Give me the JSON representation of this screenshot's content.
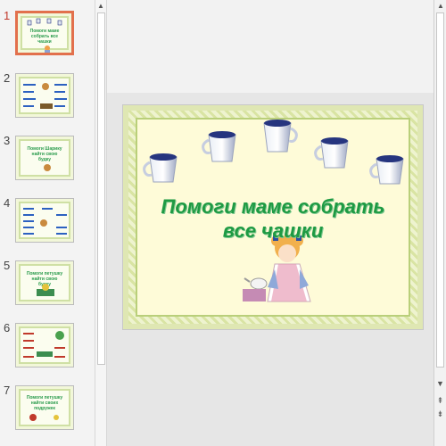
{
  "thumbnails": [
    {
      "number": "1",
      "title": "Помоги маме собрать все чашки",
      "active": true
    },
    {
      "number": "2",
      "title": "",
      "active": false
    },
    {
      "number": "3",
      "title": "Помоги Шарику найти свою будку",
      "active": false
    },
    {
      "number": "4",
      "title": "",
      "active": false
    },
    {
      "number": "5",
      "title": "Помоги петушку найти свою будку",
      "active": false
    },
    {
      "number": "6",
      "title": "",
      "active": false
    },
    {
      "number": "7",
      "title": "Помоги петушку найти своих подружек",
      "active": false
    }
  ],
  "slide": {
    "title_line1": "Помоги маме собрать",
    "title_line2": "все чашки"
  },
  "scrollbar": {
    "up_icon": "triangle-up",
    "down_icon": "triangle-down",
    "prev_slide_icon": "double-chevron-up",
    "next_slide_icon": "double-chevron-down"
  },
  "colors": {
    "title_green": "#1e9a43",
    "active_thumb_border": "#e2704c",
    "cup_blue": "#26357f"
  }
}
